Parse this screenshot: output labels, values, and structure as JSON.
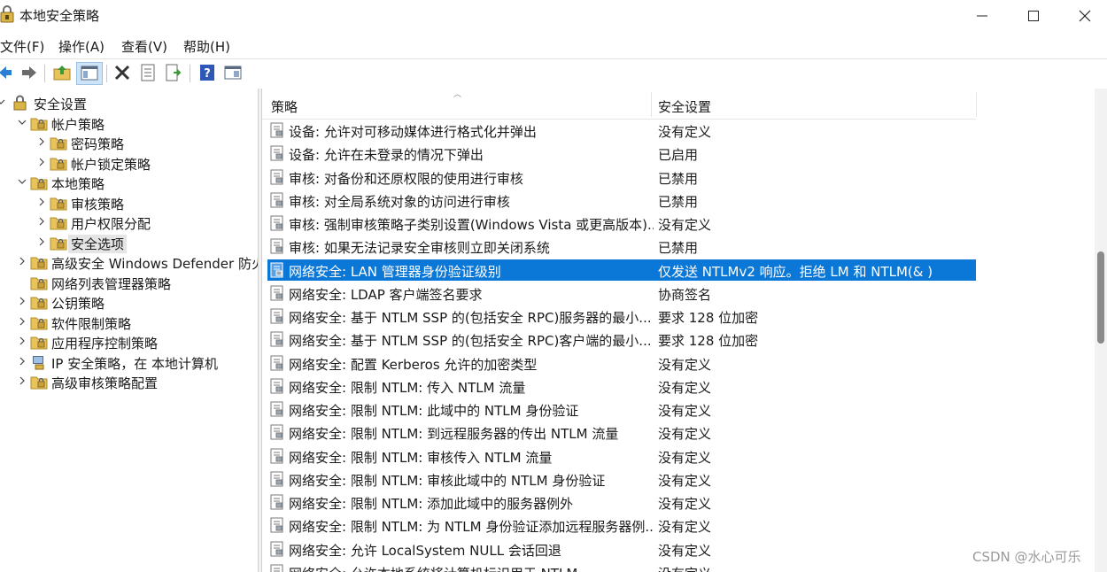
{
  "window": {
    "title": "本地安全策略"
  },
  "menu": [
    "文件(F)",
    "操作(A)",
    "查看(V)",
    "帮助(H)"
  ],
  "toolbar": [
    {
      "name": "back-icon"
    },
    {
      "name": "forward-icon"
    },
    {
      "name": "up-folder-icon"
    },
    {
      "name": "show-hide-tree-icon"
    },
    {
      "name": "delete-icon"
    },
    {
      "name": "properties-icon"
    },
    {
      "name": "export-list-icon"
    },
    {
      "name": "help-icon"
    },
    {
      "name": "view-pane-icon"
    }
  ],
  "tree": [
    {
      "label": "安全设置",
      "level": 0,
      "expand": "open"
    },
    {
      "label": "帐户策略",
      "level": 1,
      "expand": "open"
    },
    {
      "label": "密码策略",
      "level": 2,
      "expand": "closed"
    },
    {
      "label": "帐户锁定策略",
      "level": 2,
      "expand": "closed"
    },
    {
      "label": "本地策略",
      "level": 1,
      "expand": "open"
    },
    {
      "label": "审核策略",
      "level": 2,
      "expand": "closed"
    },
    {
      "label": "用户权限分配",
      "level": 2,
      "expand": "closed"
    },
    {
      "label": "安全选项",
      "level": 2,
      "expand": "closed",
      "selected": true
    },
    {
      "label": "高级安全 Windows Defender 防火墙",
      "level": 1,
      "expand": "closed"
    },
    {
      "label": "网络列表管理器策略",
      "level": 1,
      "expand": "none"
    },
    {
      "label": "公钥策略",
      "level": 1,
      "expand": "closed"
    },
    {
      "label": "软件限制策略",
      "level": 1,
      "expand": "closed"
    },
    {
      "label": "应用程序控制策略",
      "level": 1,
      "expand": "closed"
    },
    {
      "label": "IP 安全策略，在 本地计算机",
      "level": 1,
      "expand": "closed",
      "icon": "ipsec"
    },
    {
      "label": "高级审核策略配置",
      "level": 1,
      "expand": "closed"
    }
  ],
  "columns": {
    "policy": "策略",
    "setting": "安全设置"
  },
  "rows": [
    {
      "policy": "设备: 允许对可移动媒体进行格式化并弹出",
      "setting": "没有定义"
    },
    {
      "policy": "设备: 允许在未登录的情况下弹出",
      "setting": "已启用"
    },
    {
      "policy": "审核: 对备份和还原权限的使用进行审核",
      "setting": "已禁用"
    },
    {
      "policy": "审核: 对全局系统对象的访问进行审核",
      "setting": "已禁用"
    },
    {
      "policy": "审核: 强制审核策略子类别设置(Windows Vista 或更高版本)...",
      "setting": "没有定义"
    },
    {
      "policy": "审核: 如果无法记录安全审核则立即关闭系统",
      "setting": "已禁用"
    },
    {
      "policy": "网络安全: LAN 管理器身份验证级别",
      "setting": "仅发送 NTLMv2 响应。拒绝 LM 和 NTLM(& )",
      "selected": true
    },
    {
      "policy": "网络安全: LDAP 客户端签名要求",
      "setting": "协商签名"
    },
    {
      "policy": "网络安全: 基于 NTLM SSP 的(包括安全 RPC)服务器的最小...",
      "setting": "要求 128 位加密"
    },
    {
      "policy": "网络安全: 基于 NTLM SSP 的(包括安全 RPC)客户端的最小...",
      "setting": "要求 128 位加密"
    },
    {
      "policy": "网络安全: 配置 Kerberos 允许的加密类型",
      "setting": "没有定义"
    },
    {
      "policy": "网络安全: 限制 NTLM: 传入 NTLM 流量",
      "setting": "没有定义"
    },
    {
      "policy": "网络安全: 限制 NTLM: 此域中的 NTLM 身份验证",
      "setting": "没有定义"
    },
    {
      "policy": "网络安全: 限制 NTLM: 到远程服务器的传出 NTLM 流量",
      "setting": "没有定义"
    },
    {
      "policy": "网络安全: 限制 NTLM: 审核传入 NTLM 流量",
      "setting": "没有定义"
    },
    {
      "policy": "网络安全: 限制 NTLM: 审核此域中的 NTLM 身份验证",
      "setting": "没有定义"
    },
    {
      "policy": "网络安全: 限制 NTLM: 添加此域中的服务器例外",
      "setting": "没有定义"
    },
    {
      "policy": "网络安全: 限制 NTLM: 为 NTLM 身份验证添加远程服务器例...",
      "setting": "没有定义"
    },
    {
      "policy": "网络安全: 允许 LocalSystem NULL 会话回退",
      "setting": "没有定义"
    },
    {
      "policy": "网络安全: 允许本地系统将计算机标识用于 NTLM",
      "setting": "没有定义"
    }
  ],
  "watermark": "CSDN @水心可乐",
  "colors": {
    "selection": "#0b78d7",
    "folder": "#e8c25a"
  }
}
